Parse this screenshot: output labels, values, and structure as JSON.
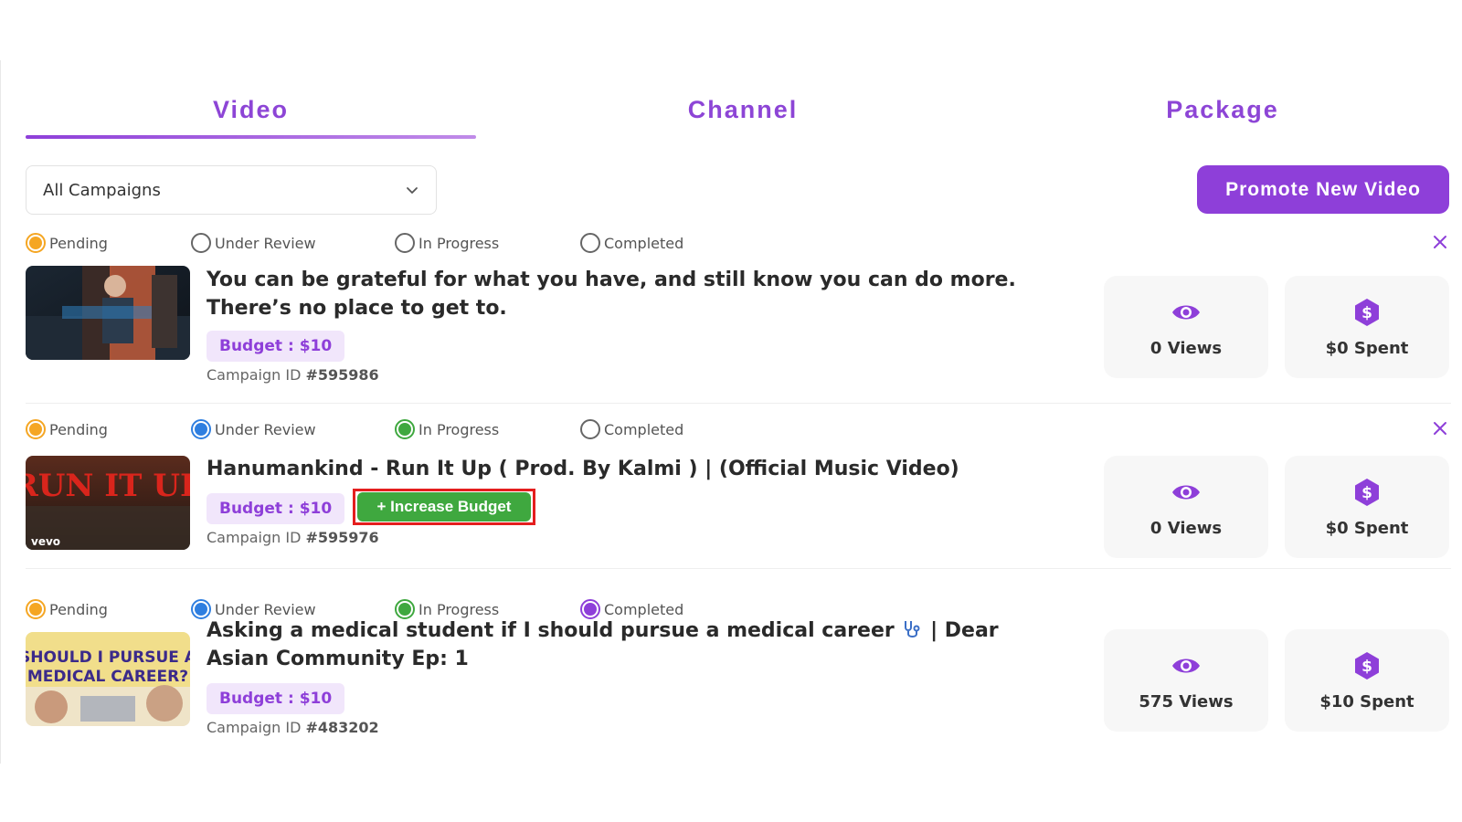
{
  "tabs": [
    {
      "label": "Video"
    },
    {
      "label": "Channel"
    },
    {
      "label": "Package"
    }
  ],
  "filter": {
    "selected": "All Campaigns"
  },
  "promote_label": "Promote New Video",
  "status_labels": [
    "Pending",
    "Under Review",
    "In Progress",
    "Completed"
  ],
  "colors": {
    "accent": "#8e3fd9",
    "pending": "#f5a623",
    "review": "#2f7fe0",
    "progress": "#3fa83f",
    "completed": "#8e3fd9"
  },
  "campaigns": [
    {
      "title": "You can be grateful for what you have, and still know you can do more. There’s no place to get to.",
      "budget": "Budget : $10",
      "campaign_id_label": "Campaign ID",
      "campaign_id": "#595986",
      "views": "0 Views",
      "spent": "$0 Spent",
      "active_statuses": [
        "Pending"
      ]
    },
    {
      "title": "Hanumankind - Run It Up ( Prod. By Kalmi ) | (Official Music Video)",
      "budget": "Budget : $10",
      "increase_label": "+ Increase Budget",
      "campaign_id_label": "Campaign ID",
      "campaign_id": "#595976",
      "views": "0 Views",
      "spent": "$0 Spent",
      "thumb_text": "RUN IT UP",
      "thumb_badge": "vevo",
      "active_statuses": [
        "Pending",
        "Under Review",
        "In Progress"
      ]
    },
    {
      "title_part1": "Asking a medical student if I should pursue a medical career",
      "title_part2": "| Dear Asian Community Ep: 1",
      "budget": "Budget : $10",
      "campaign_id_label": "Campaign ID",
      "campaign_id": "#483202",
      "views": "575 Views",
      "spent": "$10 Spent",
      "thumb_text_1": "SHOULD I PURSUE A",
      "thumb_text_2": "MEDICAL CAREER?",
      "active_statuses": [
        "Pending",
        "Under Review",
        "In Progress",
        "Completed"
      ]
    }
  ]
}
